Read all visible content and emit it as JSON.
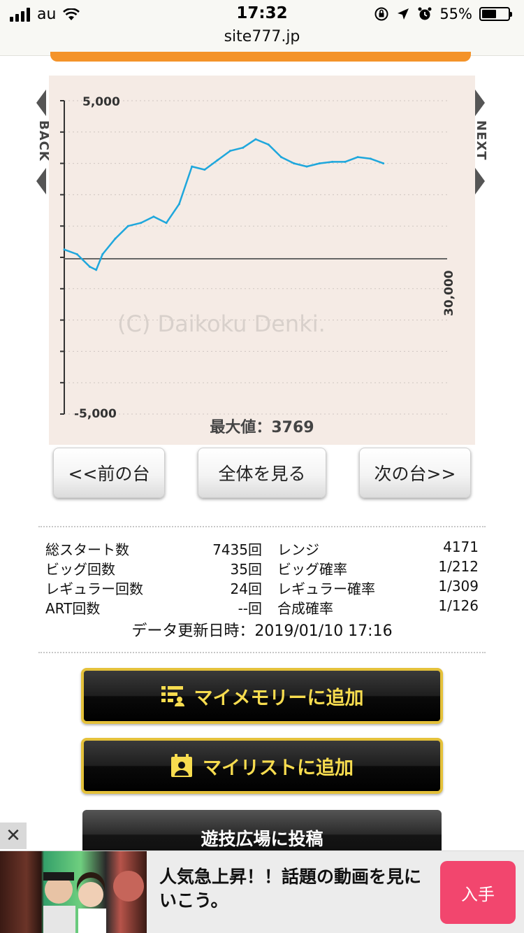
{
  "status_bar": {
    "carrier": "au",
    "time": "17:32",
    "url": "site777.jp",
    "battery": "55%",
    "battery_level": 0.55
  },
  "graph": {
    "side_back": "BACK",
    "side_next": "NEXT",
    "watermark": "(C) Daikoku Denki.",
    "max_label": "最大値：3769"
  },
  "chart_data": {
    "type": "line",
    "ytick_labels": [
      "5,000",
      "-5,000"
    ],
    "xtick_labels": [
      "30,000"
    ],
    "ylim": [
      -5000,
      5000
    ],
    "xlim": [
      0,
      30000
    ],
    "grid": true,
    "x": [
      0,
      1000,
      2000,
      2500,
      3000,
      4000,
      5000,
      6000,
      7000,
      8000,
      9000,
      10000,
      11000,
      12000,
      13000,
      14000,
      15000,
      16000,
      17000,
      18000,
      19000,
      20000,
      21000,
      22000,
      23000,
      24000,
      25000
    ],
    "values": [
      250,
      100,
      -300,
      -400,
      100,
      600,
      1000,
      1100,
      1300,
      1100,
      1700,
      2900,
      2800,
      3100,
      3400,
      3500,
      3769,
      3600,
      3200,
      3000,
      2900,
      3000,
      3050,
      3050,
      3200,
      3150,
      3000
    ]
  },
  "nav": {
    "prev": "<<前の台",
    "all": "全体を見る",
    "next": "次の台>>"
  },
  "stats": {
    "rows": [
      {
        "l1": "総スタート数",
        "v1": "7435回",
        "l2": "レンジ",
        "v2": "4171"
      },
      {
        "l1": "ビッグ回数",
        "v1": "35回",
        "l2": "ビッグ確率",
        "v2": "1/212"
      },
      {
        "l1": "レギュラー回数",
        "v1": "24回",
        "l2": "レギュラー確率",
        "v2": "1/309"
      },
      {
        "l1": "ART回数",
        "v1": "--回",
        "l2": "合成確率",
        "v2": "1/126"
      }
    ],
    "updated": "データ更新日時：2019/01/10 17:16"
  },
  "actions": {
    "memory": "マイメモリーに追加",
    "list": "マイリストに追加",
    "post": "遊技広場に投稿"
  },
  "ad": {
    "close": "✕",
    "text": "人気急上昇！！話題の動画を見にいこう。",
    "button": "入手"
  },
  "colors": {
    "line": "#1fa7dc",
    "graph_bg": "#f5ebe5",
    "gold": "#e4c13a",
    "gold_text": "#f7dc4f",
    "ad_button": "#f2466e",
    "orange": "#f4932a"
  }
}
